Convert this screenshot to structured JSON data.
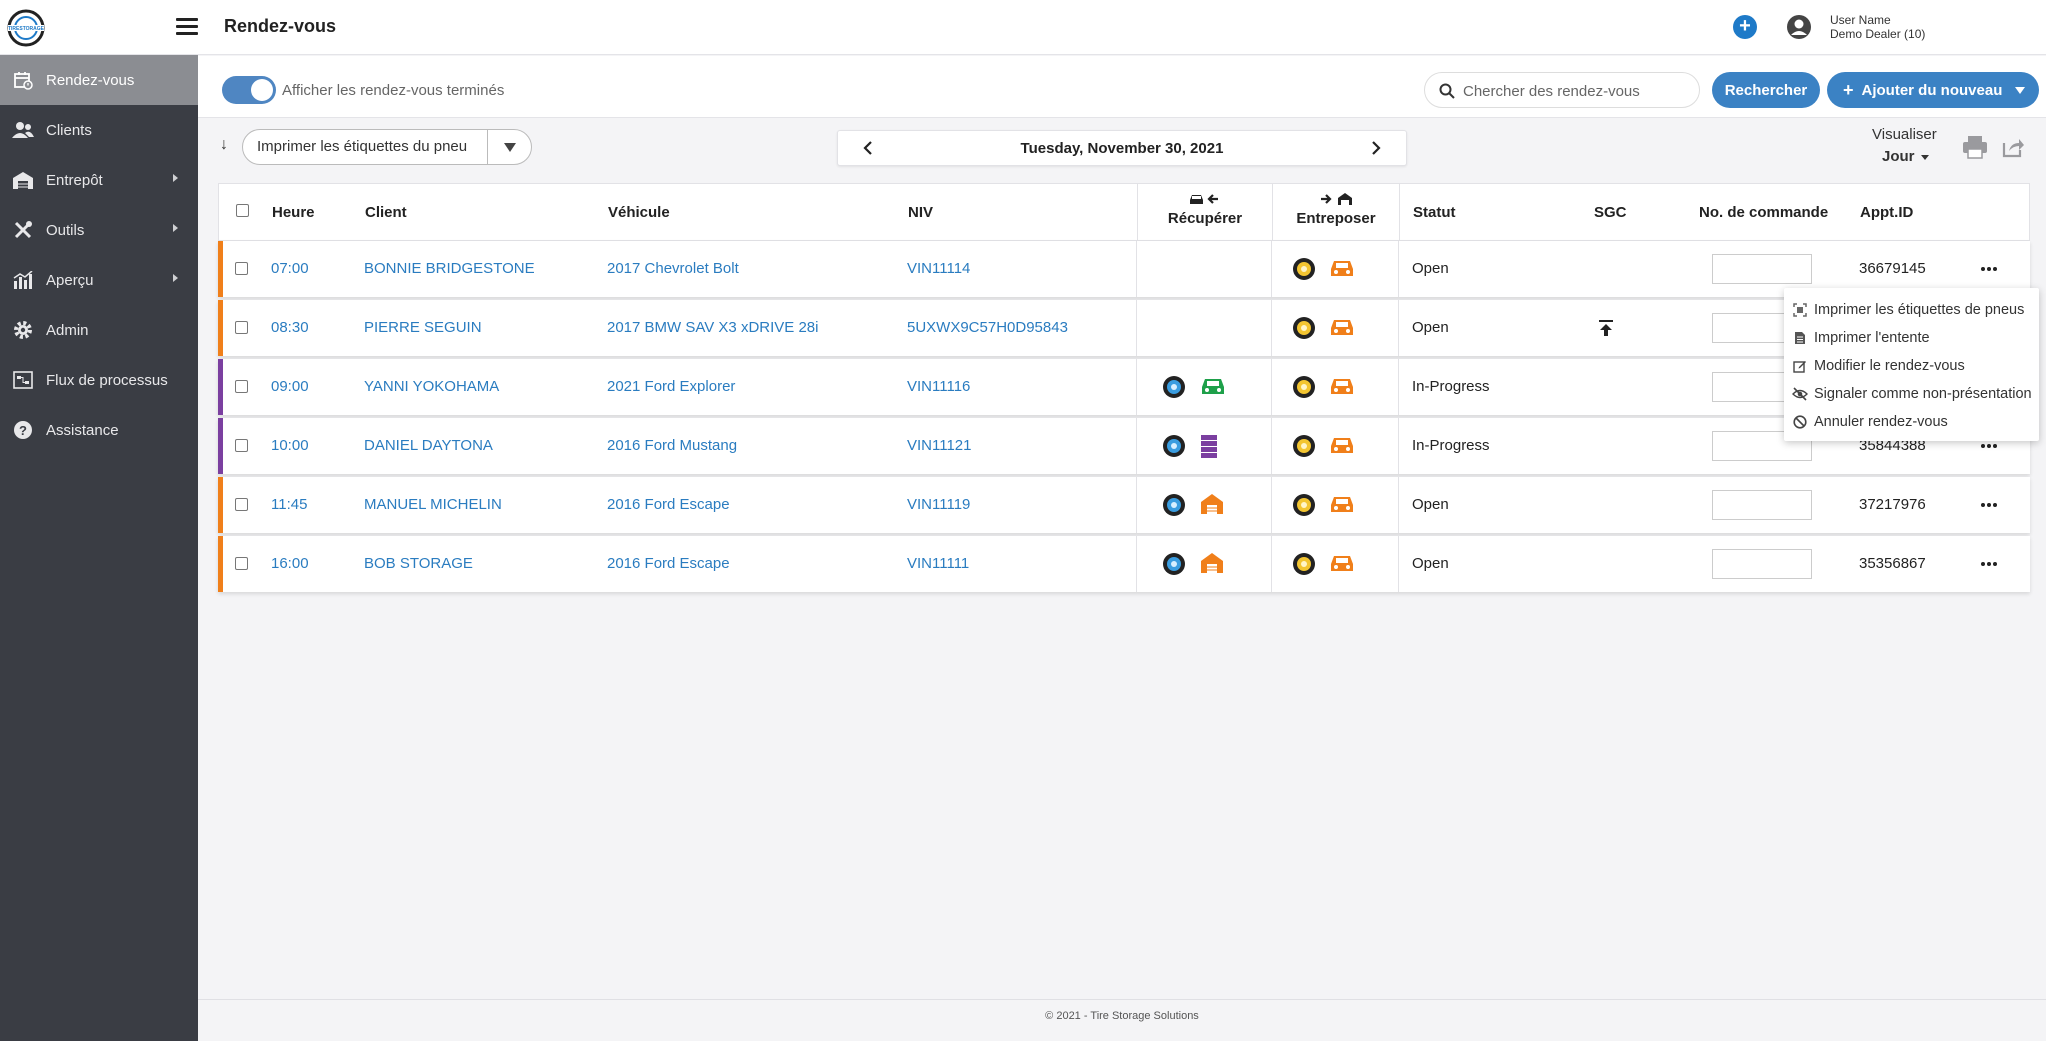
{
  "header": {
    "title": "Rendez-vous",
    "user_name": "User Name",
    "user_dealer": "Demo Dealer (10)"
  },
  "sidebar": {
    "items": [
      {
        "label": "Rendez-vous",
        "icon": "calendar-icon",
        "active": true
      },
      {
        "label": "Clients",
        "icon": "users-icon"
      },
      {
        "label": "Entrepôt",
        "icon": "warehouse-icon",
        "submenu": true
      },
      {
        "label": "Outils",
        "icon": "tools-icon",
        "submenu": true
      },
      {
        "label": "Aperçu",
        "icon": "chart-icon",
        "submenu": true
      },
      {
        "label": "Admin",
        "icon": "gear-icon"
      },
      {
        "label": "Flux de processus",
        "icon": "process-icon"
      },
      {
        "label": "Assistance",
        "icon": "help-icon"
      }
    ]
  },
  "filter": {
    "toggle_label": "Afficher les rendez-vous terminés",
    "toggle_on": true,
    "search_placeholder": "Chercher des rendez-vous",
    "search_button": "Rechercher",
    "add_button": "Ajouter du nouveau"
  },
  "toolbar": {
    "print_labels": "Imprimer les étiquettes du pneu",
    "date": "Tuesday, November 30, 2021",
    "view_label": "Visualiser",
    "view_value": "Jour"
  },
  "table": {
    "headers": {
      "time": "Heure",
      "client": "Client",
      "vehicle": "Véhicule",
      "vin": "NIV",
      "pickup": "Récupérer",
      "store": "Entreposer",
      "status": "Statut",
      "sgc": "SGC",
      "order": "No. de commande",
      "appt": "Appt.ID"
    },
    "rows": [
      {
        "time": "07:00",
        "client": "BONNIE BRIDGESTONE",
        "vehicle": "2017 Chevrolet Bolt",
        "vin": "VIN11114",
        "status": "Open",
        "appt": "36679145",
        "accent": "#f07f1a",
        "pickup": "",
        "sgc": ""
      },
      {
        "time": "08:30",
        "client": "PIERRE SEGUIN",
        "vehicle": "2017 BMW SAV X3 xDRIVE 28i",
        "vin": "5UXWX9C57H0D95843",
        "status": "Open",
        "appt": "",
        "accent": "#f07f1a",
        "pickup": "",
        "sgc": "upload"
      },
      {
        "time": "09:00",
        "client": "YANNI YOKOHAMA",
        "vehicle": "2021 Ford Explorer",
        "vin": "VIN11116",
        "status": "In-Progress",
        "appt": "",
        "accent": "#7b3fa0",
        "pickup": "car-green",
        "sgc": ""
      },
      {
        "time": "10:00",
        "client": "DANIEL DAYTONA",
        "vehicle": "2016 Ford Mustang",
        "vin": "VIN11121",
        "status": "In-Progress",
        "appt": "35844388",
        "accent": "#7b3fa0",
        "pickup": "stack-purple",
        "sgc": ""
      },
      {
        "time": "11:45",
        "client": "MANUEL MICHELIN",
        "vehicle": "2016 Ford Escape",
        "vin": "VIN11119",
        "status": "Open",
        "appt": "37217976",
        "accent": "#f07f1a",
        "pickup": "warehouse-orange",
        "sgc": ""
      },
      {
        "time": "16:00",
        "client": "BOB STORAGE",
        "vehicle": "2016 Ford Escape",
        "vin": "VIN11111",
        "status": "Open",
        "appt": "35356867",
        "accent": "#f07f1a",
        "pickup": "warehouse-orange",
        "sgc": ""
      }
    ]
  },
  "context_menu": {
    "items": [
      {
        "label": "Imprimer les étiquettes de pneus",
        "icon": "scan-icon"
      },
      {
        "label": "Imprimer l'entente",
        "icon": "document-icon"
      },
      {
        "label": "Modifier le rendez-vous",
        "icon": "edit-icon"
      },
      {
        "label": "Signaler comme non-présentation",
        "icon": "eye-slash-icon"
      },
      {
        "label": "Annuler rendez-vous",
        "icon": "ban-icon"
      }
    ]
  },
  "footer": {
    "text": "© 2021 - Tire Storage Solutions"
  },
  "colors": {
    "accent_blue": "#3b82c4",
    "link_blue": "#2a7cc0",
    "orange": "#f07f1a",
    "purple": "#7b3fa0",
    "sidebar": "#3a3d44"
  }
}
